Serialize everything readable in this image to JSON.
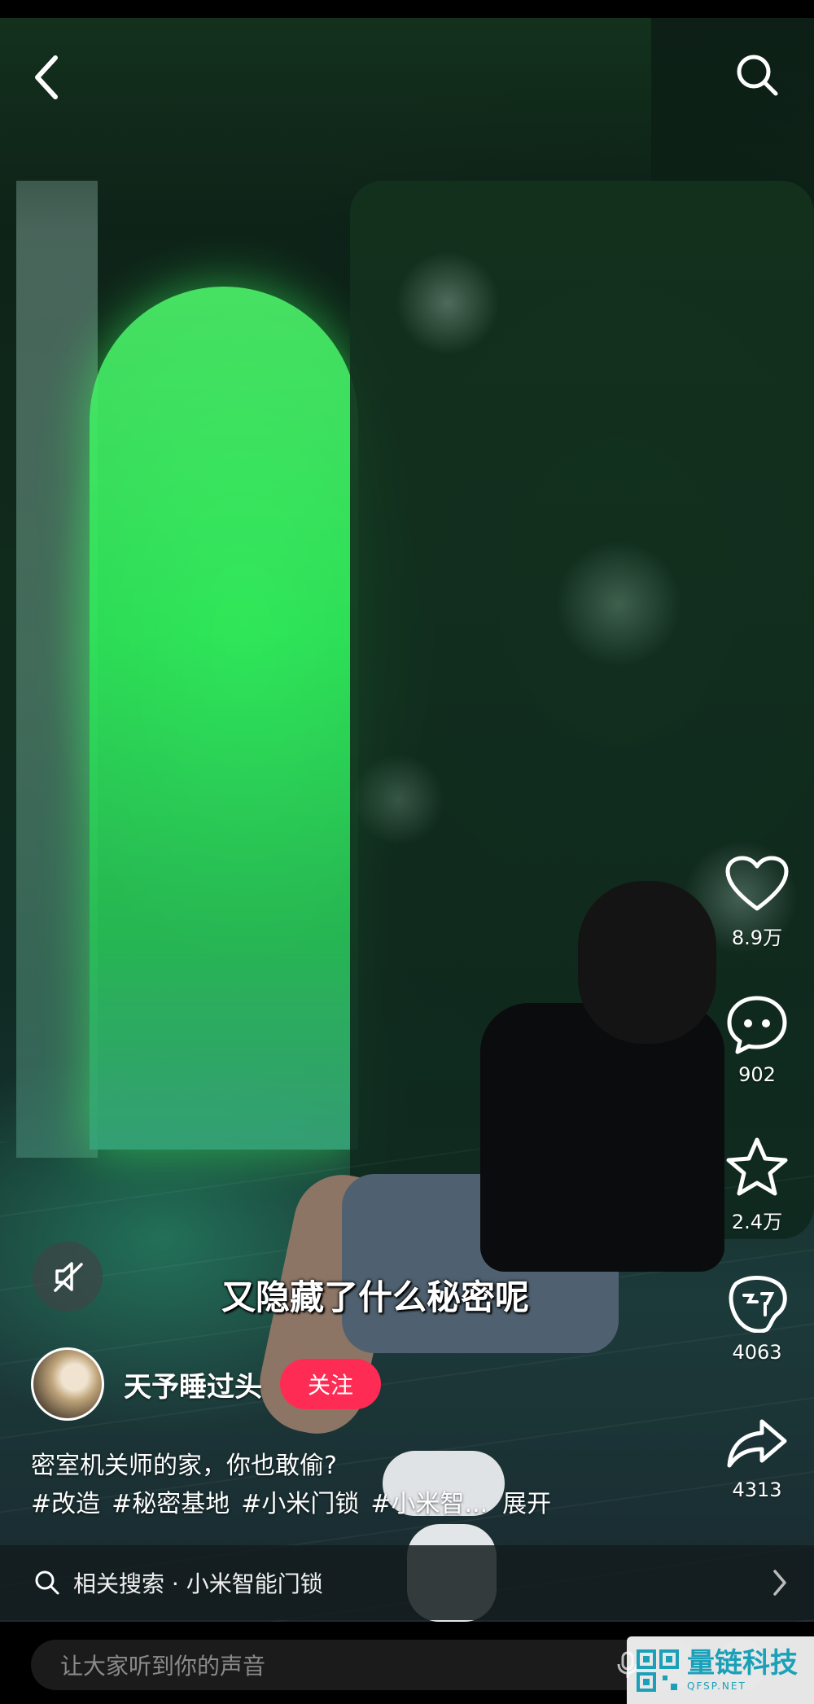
{
  "video": {
    "subtitle": "又隐藏了什么秘密呢"
  },
  "nav": {
    "back_icon": "chevron-left-icon",
    "search_icon": "search-icon"
  },
  "actions": {
    "likes": "8.9万",
    "comments": "902",
    "favorites": "2.4万",
    "recommend": "4063",
    "shares": "4313"
  },
  "author": {
    "name": "天予睡过头",
    "follow_label": "关注"
  },
  "post": {
    "description": "密室机关师的家，你也敢偷?",
    "tags": [
      "#改造",
      "#秘密基地",
      "#小米门锁",
      "#小米智..."
    ],
    "expand_label": "展开"
  },
  "related_search": {
    "label": "相关搜索 · 小米智能门锁"
  },
  "comment_bar": {
    "placeholder": "让大家听到你的声音"
  },
  "watermark": {
    "title": "量链科技",
    "subtitle": "QFSP.NET"
  },
  "colors": {
    "follow_button": "#fe2c55",
    "watermark_accent": "#1aa0b8"
  }
}
